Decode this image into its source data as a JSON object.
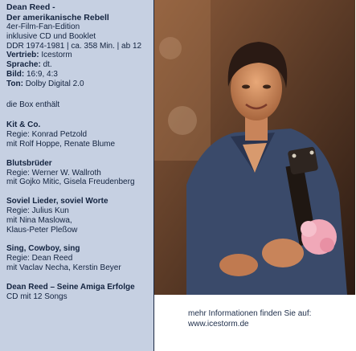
{
  "product": {
    "artist": "Dean Reed -",
    "subtitle": "Der amerikanische Rebell",
    "edition": "4er-Film-Fan-Edition",
    "extras": "inklusive CD und Booklet",
    "meta": "DDR 1974-1981 | ca. 358 Min. | ab 12"
  },
  "specs": [
    {
      "label": "Vertrieb:",
      "value": "Icestorm"
    },
    {
      "label": "Sprache:",
      "value": "dt."
    },
    {
      "label": "Bild:",
      "value": "16:9, 4:3"
    },
    {
      "label": "Ton:",
      "value": "Dolby Digital 2.0"
    }
  ],
  "box_intro": "die Box enthält",
  "films": [
    {
      "title": "Kit & Co.",
      "director": "Regie: Konrad Petzold",
      "cast": [
        "mit Rolf Hoppe, Renate Blume"
      ]
    },
    {
      "title": "Blutsbrüder",
      "director": "Regie: Werner W. Wallroth",
      "cast": [
        "mit Gojko Mitic, Gisela Freudenberg"
      ]
    },
    {
      "title": "Soviel Lieder, soviel Worte",
      "director": "Regie: Julius Kun",
      "cast": [
        "mit Nina Maslowa,",
        "Klaus-Peter Pleßow"
      ]
    },
    {
      "title": "Sing, Cowboy, sing",
      "director": "Regie: Dean Reed",
      "cast": [
        "mit Vaclav Necha, Kerstin Beyer"
      ]
    }
  ],
  "bonus": {
    "title": "Dean Reed – Seine Amiga Erfolge",
    "detail": "CD mit 12 Songs"
  },
  "more_info": {
    "line1": "mehr Informationen finden Sie auf:",
    "url": "www.icestorm.de"
  },
  "colors": {
    "panel_bg": "#c6d0e2",
    "text": "#13233f",
    "divider": "#1c2a44"
  }
}
